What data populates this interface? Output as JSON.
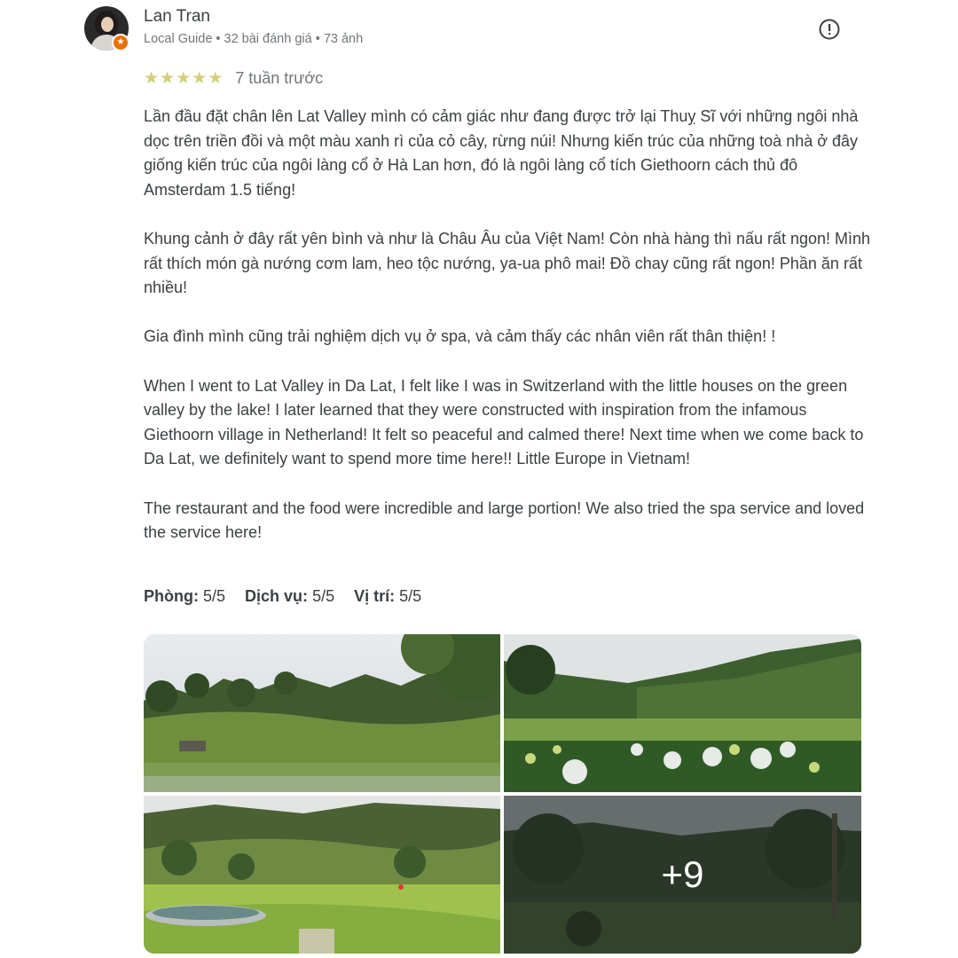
{
  "author": {
    "name": "Lan Tran",
    "meta": "Local Guide • 32 bài đánh giá • 73 ảnh"
  },
  "review": {
    "rating": 5,
    "date": "7 tuần trước",
    "paragraphs": [
      "Lần đầu đặt chân lên Lat Valley mình có cảm giác như đang được trở lại Thuỵ Sĩ với những ngôi nhà dọc trên triền đồi và một màu xanh rì của cỏ cây, rừng núi! Nhưng kiến trúc của những toà nhà ở đây giống kiến trúc của ngôi làng cổ ở Hà Lan hơn, đó là ngôi làng cổ tích Giethoorn cách thủ đô Amsterdam 1.5 tiếng!",
      "Khung cảnh ở đây rất yên bình và như là Châu Âu của Việt Nam! Còn nhà hàng thì nấu rất ngon! Mình rất thích món gà nướng cơm lam, heo tộc nướng, ya-ua phô mai! Đồ chay cũng rất ngon! Phần ăn rất nhiều!",
      "Gia đình mình cũng trải nghiệm dịch vụ ở spa, và cảm thấy các nhân viên rất thân thiện! !",
      "When I went to Lat Valley in Da Lat, I felt like I was in Switzerland with the little houses on the green valley by the lake! I later learned that they were constructed with inspiration from the infamous Giethoorn village in Netherland! It felt so peaceful and calmed there! Next time when we come back to Da Lat, we definitely want to spend more time here!! Little Europe in Vietnam!",
      "The restaurant and the food were incredible and large portion! We also tried the spa service and loved the service here!"
    ]
  },
  "sub_ratings": [
    {
      "label": "Phòng:",
      "value": "5/5"
    },
    {
      "label": "Dịch vụ:",
      "value": "5/5"
    },
    {
      "label": "Vị trí:",
      "value": "5/5"
    }
  ],
  "photos": {
    "more_count": "+9"
  },
  "colors": {
    "star": "#d1cf79",
    "text": "#3c4043",
    "muted": "#70757a",
    "guide_badge": "#e8710a"
  },
  "icons": {
    "report": "report-icon",
    "star": "star-icon"
  }
}
